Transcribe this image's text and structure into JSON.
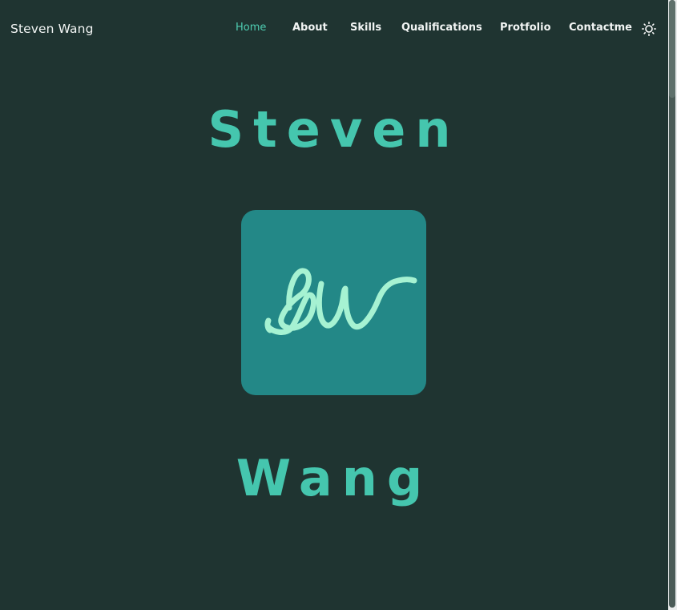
{
  "brand": "Steven Wang",
  "nav": {
    "home": "Home",
    "about": "About",
    "skills": "Skills",
    "qualifications": "Qualifications",
    "portfolio": "Protfolio",
    "contact": "Contactme",
    "active": "Home"
  },
  "hero": {
    "first_name": "Steven",
    "last_name": "Wang",
    "logo_signature": "SW"
  },
  "colors": {
    "background": "#1f3431",
    "accent": "#45c6ae",
    "logo_bg": "#238887",
    "logo_stroke": "#a6f2d2"
  },
  "icons": {
    "theme_toggle": "sun-icon"
  }
}
